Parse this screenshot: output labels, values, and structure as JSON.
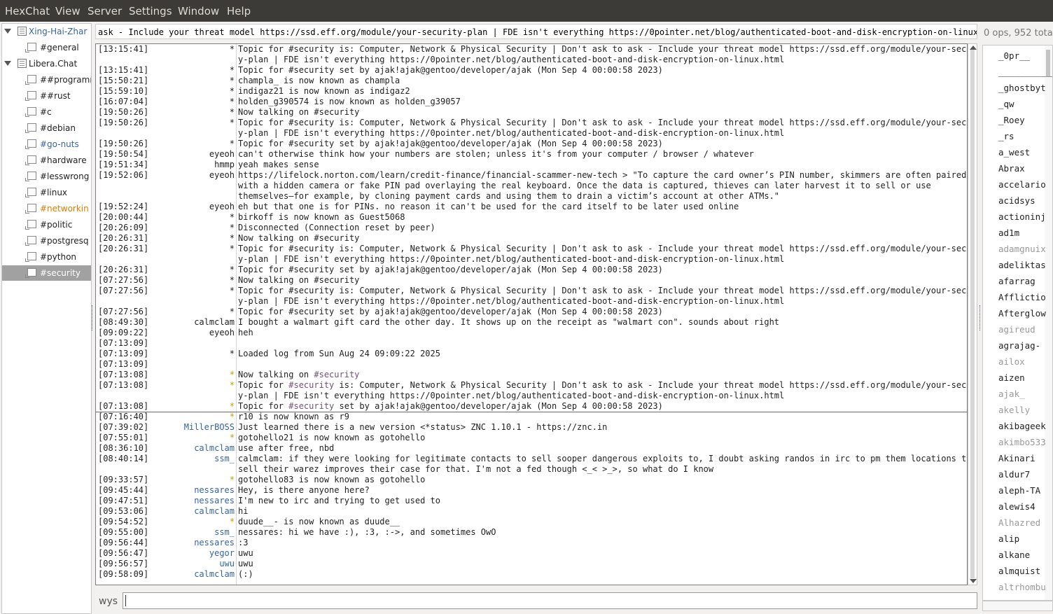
{
  "menu": [
    "HexChat",
    "View",
    "Server",
    "Settings",
    "Window",
    "Help"
  ],
  "tree": [
    {
      "label": "Xing-Hai-Zhar",
      "type": "server",
      "color": "#3465a4",
      "selected": false
    },
    {
      "label": "#general",
      "type": "channel",
      "color": "#222222",
      "selected": false
    },
    {
      "label": "Libera.Chat",
      "type": "server",
      "color": "#222222",
      "selected": false
    },
    {
      "label": "##programm",
      "type": "channel",
      "color": "#222222",
      "selected": false
    },
    {
      "label": "##rust",
      "type": "channel",
      "color": "#222222",
      "selected": false
    },
    {
      "label": "#c",
      "type": "channel",
      "color": "#222222",
      "selected": false
    },
    {
      "label": "#debian",
      "type": "channel",
      "color": "#222222",
      "selected": false
    },
    {
      "label": "#go-nuts",
      "type": "channel",
      "color": "#3465a4",
      "selected": false
    },
    {
      "label": "#hardware",
      "type": "channel",
      "color": "#222222",
      "selected": false
    },
    {
      "label": "#lesswrong",
      "type": "channel",
      "color": "#222222",
      "selected": false
    },
    {
      "label": "#linux",
      "type": "channel",
      "color": "#222222",
      "selected": false
    },
    {
      "label": "#networkin",
      "type": "channel",
      "color": "#e07b00",
      "selected": false
    },
    {
      "label": "#politic",
      "type": "channel",
      "color": "#222222",
      "selected": false
    },
    {
      "label": "#postgresq",
      "type": "channel",
      "color": "#222222",
      "selected": false
    },
    {
      "label": "#python",
      "type": "channel",
      "color": "#222222",
      "selected": false
    },
    {
      "label": "#security",
      "type": "channel",
      "color": "#ffffff",
      "selected": true
    }
  ],
  "topic": "ask - Include your threat model https://ssd.eff.org/module/your-security-plan | FDE isn't everything https://0pointer.net/blog/authenticated-boot-and-disk-encryption-on-linux.html",
  "ops_summary": "0 ops, 952 tota",
  "messages": [
    {
      "ts": "[13:15:41]",
      "nick": "*",
      "text": "Topic for #security is: Computer, Network & Physical Security | Don't ask to ask - Include your threat model https://ssd.eff.org/module/your-securit"
    },
    {
      "ts": "",
      "nick": "",
      "text": "y-plan | FDE isn't everything https://0pointer.net/blog/authenticated-boot-and-disk-encryption-on-linux.html"
    },
    {
      "ts": "[13:15:41]",
      "nick": "*",
      "text": "Topic for #security set by ajak!ajak@gentoo/developer/ajak (Mon Sep  4 00:00:58 2023)"
    },
    {
      "ts": "[15:50:21]",
      "nick": "*",
      "text": "champla_ is now known as champla"
    },
    {
      "ts": "[15:59:10]",
      "nick": "*",
      "text": "indigaz21 is now known as indigaz2"
    },
    {
      "ts": "[16:07:04]",
      "nick": "*",
      "text": "holden_g390574 is now known as holden_g39057"
    },
    {
      "ts": "[19:50:26]",
      "nick": "*",
      "text": "Now talking on #security"
    },
    {
      "ts": "[19:50:26]",
      "nick": "*",
      "text": "Topic for #security is: Computer, Network & Physical Security | Don't ask to ask - Include your threat model https://ssd.eff.org/module/your-securit"
    },
    {
      "ts": "",
      "nick": "",
      "text": "y-plan | FDE isn't everything https://0pointer.net/blog/authenticated-boot-and-disk-encryption-on-linux.html"
    },
    {
      "ts": "[19:50:26]",
      "nick": "*",
      "text": "Topic for #security set by ajak!ajak@gentoo/developer/ajak (Mon Sep  4 00:00:58 2023)"
    },
    {
      "ts": "[19:50:54]",
      "nick": "eyeoh",
      "text": "can't otherwise think how your numbers are stolen; unless it's from your computer / browser / whatever"
    },
    {
      "ts": "[19:51:34]",
      "nick": "hmmp",
      "text": "yeah makes sense"
    },
    {
      "ts": "[19:52:06]",
      "nick": "eyeoh",
      "text": "https://lifelock.norton.com/learn/credit-finance/financial-scammer-new-tech > \"To capture the card owner’s PIN number, skimmers are often paired"
    },
    {
      "ts": "",
      "nick": "",
      "text": "with a hidden camera or fake PIN pad overlaying the real keyboard. Once the data is captured, thieves can later harvest it to sell or use"
    },
    {
      "ts": "",
      "nick": "",
      "text": "themselves—for example, by cloning payment cards and using them to drain a victim’s account at other ATMs.\""
    },
    {
      "ts": "[19:52:24]",
      "nick": "eyeoh",
      "text": "eh but that one is for PINs. no reason it can't be used for the card itself to be later used online"
    },
    {
      "ts": "[20:00:44]",
      "nick": "*",
      "text": "birkoff is now known as Guest5068"
    },
    {
      "ts": "[20:26:09]",
      "nick": "*",
      "text": "Disconnected (Connection reset by peer)"
    },
    {
      "ts": "[20:26:31]",
      "nick": "*",
      "text": "Now talking on #security"
    },
    {
      "ts": "[20:26:31]",
      "nick": "*",
      "text": "Topic for #security is: Computer, Network & Physical Security | Don't ask to ask - Include your threat model https://ssd.eff.org/module/your-securit"
    },
    {
      "ts": "",
      "nick": "",
      "text": "y-plan | FDE isn't everything https://0pointer.net/blog/authenticated-boot-and-disk-encryption-on-linux.html"
    },
    {
      "ts": "[20:26:31]",
      "nick": "*",
      "text": "Topic for #security set by ajak!ajak@gentoo/developer/ajak (Mon Sep  4 00:00:58 2023)"
    },
    {
      "ts": "[07:27:56]",
      "nick": "*",
      "text": "Now talking on #security"
    },
    {
      "ts": "[07:27:56]",
      "nick": "*",
      "text": "Topic for #security is: Computer, Network & Physical Security | Don't ask to ask - Include your threat model https://ssd.eff.org/module/your-securit"
    },
    {
      "ts": "",
      "nick": "",
      "text": "y-plan | FDE isn't everything https://0pointer.net/blog/authenticated-boot-and-disk-encryption-on-linux.html"
    },
    {
      "ts": "[07:27:56]",
      "nick": "*",
      "text": "Topic for #security set by ajak!ajak@gentoo/developer/ajak (Mon Sep  4 00:00:58 2023)"
    },
    {
      "ts": "[08:49:30]",
      "nick": "calmclam",
      "text": "I bought a walmart gift card the other day. It shows up on the receipt as \"walmart con\". sounds about right"
    },
    {
      "ts": "[09:09:22]",
      "nick": "eyeoh",
      "text": "heh"
    },
    {
      "ts": "[07:13:09]",
      "nick": "",
      "text": ""
    },
    {
      "ts": "[07:13:09]",
      "nick": "*",
      "text": "Loaded log from Sun Aug 24 09:09:22 2025"
    },
    {
      "ts": "[07:13:09]",
      "nick": "",
      "text": ""
    },
    {
      "ts": "[07:13:08]",
      "nick": "*",
      "nick_color": "#c4a000",
      "text": "Now talking on #security",
      "hl": [
        "#security",
        "#75507b"
      ]
    },
    {
      "ts": "[07:13:08]",
      "nick": "*",
      "nick_color": "#c4a000",
      "text": "Topic for #security is: Computer, Network & Physical Security | Don't ask to ask - Include your threat model https://ssd.eff.org/module/your-securit",
      "hl": [
        "#security",
        "#75507b"
      ]
    },
    {
      "ts": "",
      "nick": "",
      "text": "y-plan | FDE isn't everything https://0pointer.net/blog/authenticated-boot-and-disk-encryption-on-linux.html"
    },
    {
      "ts": "[07:13:08]",
      "nick": "*",
      "nick_color": "#c4a000",
      "text": "Topic for #security set by ajak!ajak@gentoo/developer/ajak (Mon Sep  4 00:00:58 2023)",
      "hl": [
        "#security",
        "#75507b"
      ]
    },
    {
      "ts": "[07:16:40]",
      "nick": "*",
      "nick_color": "#c4a000",
      "text": "r10 is now known as r9",
      "color": "#222222"
    },
    {
      "ts": "[07:39:02]",
      "nick": "MillerBOSS",
      "nick_color": "#3465a4",
      "text": "Just learned there is a new version  <*status> ZNC 1.10.1 - https://znc.in"
    },
    {
      "ts": "[07:55:01]",
      "nick": "*",
      "nick_color": "#c4a000",
      "text": "gotohello21 is now known as gotohello"
    },
    {
      "ts": "[08:36:10]",
      "nick": "calmclam",
      "nick_color": "#3465a4",
      "text": "use after free, nbd"
    },
    {
      "ts": "[08:40:14]",
      "nick": "ssm_",
      "nick_color": "#3465a4",
      "text": "calmclam: if they were looking for legitimate contacts to sell sooper dangerous exploits to, I doubt asking randos in irc to pm them locations to"
    },
    {
      "ts": "",
      "nick": "",
      "text": "sell their warez improves their case for that. I'm not a fed though <_< >_>, so what do I know"
    },
    {
      "ts": "[09:33:57]",
      "nick": "*",
      "nick_color": "#c4a000",
      "text": "gotohello83 is now known as gotohello"
    },
    {
      "ts": "[09:45:44]",
      "nick": "nessares",
      "nick_color": "#3465a4",
      "text": "Hey, is there anyone here?"
    },
    {
      "ts": "[09:47:51]",
      "nick": "nessares",
      "nick_color": "#3465a4",
      "text": "I'm new to irc and trying to get used to"
    },
    {
      "ts": "[09:53:06]",
      "nick": "calmclam",
      "nick_color": "#3465a4",
      "text": "hi"
    },
    {
      "ts": "[09:54:52]",
      "nick": "*",
      "nick_color": "#c4a000",
      "text": "duude__- is now known as duude__"
    },
    {
      "ts": "[09:55:00]",
      "nick": "ssm_",
      "nick_color": "#3465a4",
      "text": "nessares: hi we have :), :3, :->, and sometimes OwO"
    },
    {
      "ts": "[09:56:44]",
      "nick": "nessares",
      "nick_color": "#3465a4",
      "text": ":3"
    },
    {
      "ts": "[09:56:47]",
      "nick": "yegor",
      "nick_color": "#3465a4",
      "text": "uwu"
    },
    {
      "ts": "[09:56:57]",
      "nick": "uwu",
      "nick_color": "#3465a4",
      "text": "uwu"
    },
    {
      "ts": "[09:58:09]",
      "nick": "calmclam",
      "nick_color": "#3465a4",
      "text": "(:)"
    }
  ],
  "users": [
    {
      "name": "_0pr__",
      "away": false
    },
    {
      "name": "_____________",
      "away": false
    },
    {
      "name": "_ghostbyt",
      "away": false
    },
    {
      "name": "_qw",
      "away": false
    },
    {
      "name": "_Roey",
      "away": false
    },
    {
      "name": "_rs",
      "away": false
    },
    {
      "name": "a_west",
      "away": false
    },
    {
      "name": "Abrax",
      "away": false
    },
    {
      "name": "accelario",
      "away": false
    },
    {
      "name": "acidsys",
      "away": false
    },
    {
      "name": "actioninj",
      "away": false
    },
    {
      "name": "ad1m",
      "away": false
    },
    {
      "name": "adamgnuix",
      "away": true
    },
    {
      "name": "adeliktas",
      "away": false
    },
    {
      "name": "afarrag",
      "away": false
    },
    {
      "name": "Afflictio",
      "away": false
    },
    {
      "name": "Afterglow",
      "away": false
    },
    {
      "name": "agireud",
      "away": true
    },
    {
      "name": "agrajag-",
      "away": false
    },
    {
      "name": "ailox",
      "away": true
    },
    {
      "name": "aizen",
      "away": false
    },
    {
      "name": "ajak_",
      "away": true
    },
    {
      "name": "akelly",
      "away": true
    },
    {
      "name": "akibageek",
      "away": false
    },
    {
      "name": "akimbo533",
      "away": true
    },
    {
      "name": "Akinari",
      "away": false
    },
    {
      "name": "aldur7",
      "away": false
    },
    {
      "name": "aleph-TA",
      "away": false
    },
    {
      "name": "alewis4",
      "away": false
    },
    {
      "name": "Alhazred",
      "away": true
    },
    {
      "name": "alip",
      "away": false
    },
    {
      "name": "alkane",
      "away": false
    },
    {
      "name": "almquist",
      "away": false
    },
    {
      "name": "altrhombu",
      "away": true
    }
  ],
  "input": {
    "nick": "wys",
    "value": ""
  },
  "colors": {
    "menubar": "#3c3b37",
    "action": "#c4a000",
    "nick": "#3465a4",
    "channel": "#75507b",
    "away": "#999999"
  }
}
